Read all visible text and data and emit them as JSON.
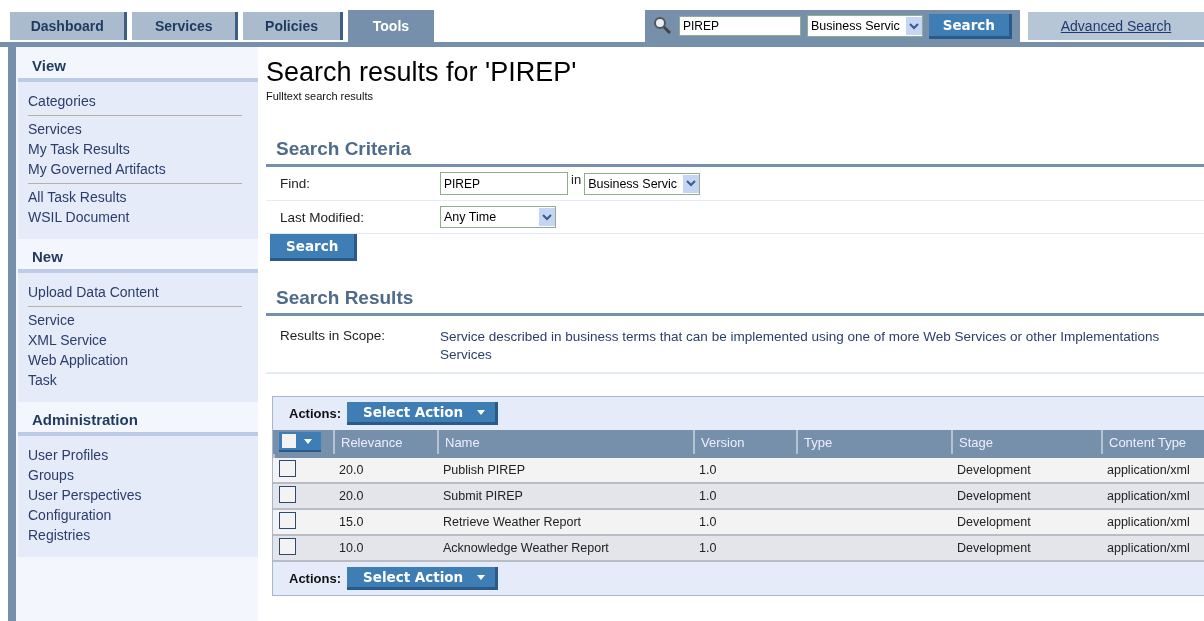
{
  "tabs": [
    {
      "label": "Dashboard",
      "selected": false
    },
    {
      "label": "Services",
      "selected": false
    },
    {
      "label": "Policies",
      "selected": false
    },
    {
      "label": "Tools",
      "selected": true
    }
  ],
  "top_search": {
    "value": "PIREP",
    "scope": "Business Servic",
    "button": "Search",
    "advanced_link": "Advanced Search"
  },
  "sidebar": [
    {
      "title": "View",
      "groups": [
        [
          "Categories"
        ],
        [
          "Services",
          "My Task Results",
          "My Governed Artifacts"
        ],
        [
          "All Task Results",
          "WSIL Document"
        ]
      ]
    },
    {
      "title": "New",
      "groups": [
        [
          "Upload Data Content"
        ],
        [
          "Service",
          "XML Service",
          "Web Application",
          "Task"
        ]
      ]
    },
    {
      "title": "Administration",
      "groups": [
        [
          "User Profiles",
          "Groups",
          "User Perspectives",
          "Configuration",
          "Registries"
        ]
      ]
    }
  ],
  "page_title": "Search results for 'PIREP'",
  "page_subtitle": "Fulltext search results",
  "criteria": {
    "heading": "Search Criteria",
    "find_label": "Find:",
    "find_value": "PIREP",
    "in_label": "in",
    "scope": "Business Servic",
    "modified_label": "Last Modified:",
    "modified_value": "Any Time",
    "button": "Search"
  },
  "results": {
    "heading": "Search Results",
    "scope_label": "Results in Scope:",
    "scope_text": "Service described in business terms that can be implemented using one of more Web Services or other Implementations Services",
    "action_bars": [
      {
        "label": "Actions:",
        "button": "Select Action"
      },
      {
        "label": "Actions:",
        "button": "Select Action"
      }
    ],
    "select_all": {
      "checked": false
    },
    "columns": [
      "Relevance",
      "Name",
      "Version",
      "Type",
      "Stage",
      "Content Type"
    ],
    "rows": [
      {
        "checked": false,
        "cells": [
          "20.0",
          "Publish PIREP",
          "1.0",
          "",
          "Development",
          "application/xml"
        ]
      },
      {
        "checked": false,
        "cells": [
          "20.0",
          "Submit PIREP",
          "1.0",
          "",
          "Development",
          "application/xml"
        ]
      },
      {
        "checked": false,
        "cells": [
          "15.0",
          "Retrieve Weather Report",
          "1.0",
          "",
          "Development",
          "application/xml"
        ]
      },
      {
        "checked": false,
        "cells": [
          "10.0",
          "Acknowledge Weather Report",
          "1.0",
          "",
          "Development",
          "application/xml"
        ]
      }
    ]
  }
}
